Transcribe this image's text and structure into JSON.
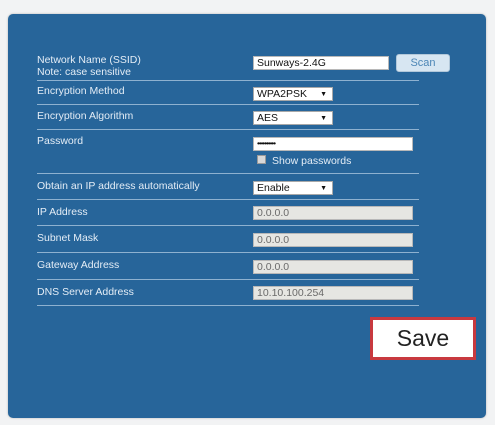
{
  "form": {
    "ssid": {
      "label": "Network Name (SSID)",
      "note": "Note: case sensitive",
      "value": "Sunways-2.4G",
      "scan_label": "Scan"
    },
    "encryption_method": {
      "label": "Encryption Method",
      "value": "WPA2PSK"
    },
    "encryption_algorithm": {
      "label": "Encryption Algorithm",
      "value": "AES"
    },
    "password": {
      "label": "Password",
      "value": "••••••••••",
      "show_label": "Show passwords",
      "show_checked": false
    },
    "obtain_ip": {
      "label": "Obtain an IP address automatically",
      "value": "Enable"
    },
    "ip_address": {
      "label": "IP Address",
      "value": "0.0.0.0"
    },
    "subnet_mask": {
      "label": "Subnet Mask",
      "value": "0.0.0.0"
    },
    "gateway": {
      "label": "Gateway Address",
      "value": "0.0.0.0"
    },
    "dns": {
      "label": "DNS Server Address",
      "value": "10.10.100.254"
    }
  },
  "actions": {
    "save_label": "Save"
  },
  "colors": {
    "panel": "#27659a",
    "save_border": "#c8393f",
    "scan_button": "#d7e6f2"
  }
}
